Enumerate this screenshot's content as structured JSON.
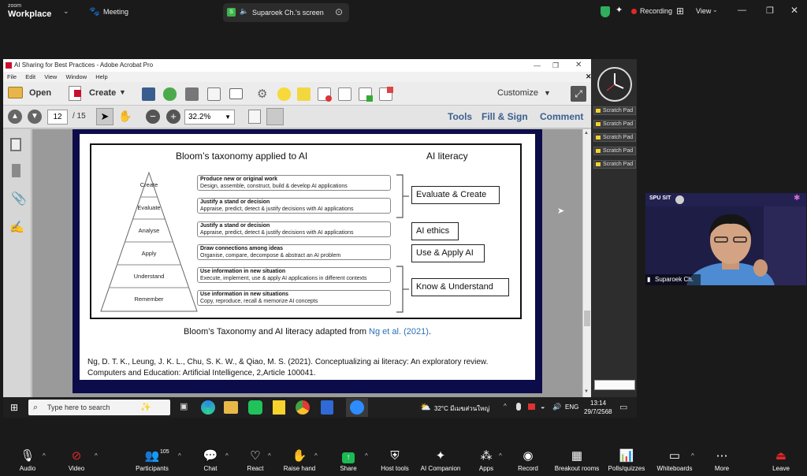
{
  "zoom_top": {
    "logo_line1": "zoom",
    "logo_line2": "Workplace",
    "meeting_label": "Meeting",
    "screen_owner": "Suparoek Ch.'s screen",
    "recording_label": "Recording",
    "view_label": "View"
  },
  "acrobat": {
    "title": "AI Sharing for Best Practices - Adobe Acrobat Pro",
    "menu": [
      "File",
      "Edit",
      "View",
      "Window",
      "Help"
    ],
    "open_label": "Open",
    "create_label": "Create",
    "customize_label": "Customize",
    "page_current": "12",
    "page_total": "/ 15",
    "zoom_value": "32.2%",
    "tools_label": "Tools",
    "fill_sign_label": "Fill & Sign",
    "comment_label": "Comment"
  },
  "slide": {
    "title": "Bloom’s taxonomy applied to AI",
    "literacy_title": "AI literacy",
    "pyramid": [
      "Create",
      "Evaluate",
      "Analyse",
      "Apply",
      "Understand",
      "Remember"
    ],
    "levels": [
      {
        "head": "Produce new or original work",
        "desc": "Design, assemble, construct, build & develop AI applications"
      },
      {
        "head": "Justify a stand or decision",
        "desc": "Appraise, predict, detect & justify decisions with AI applications"
      },
      {
        "head": "Justify a stand or decision",
        "desc": "Appraise, predict, detect & justify decisions with AI applications"
      },
      {
        "head": "Draw connections among ideas",
        "desc": "Organise, compare, decompose & abstract an AI problem"
      },
      {
        "head": "Use information in new situation",
        "desc": "Execute, implement, use & apply AI applications in different contexts"
      },
      {
        "head": "Use information in new situations",
        "desc": "Copy, reproduce, recall & memorize AI concepts"
      }
    ],
    "literacy": [
      "Evaluate & Create",
      "AI ethics",
      "Use & Apply AI",
      "Know & Understand"
    ],
    "caption_text": "Bloom’s Taxonomy and AI literacy adapted from ",
    "caption_link": "Ng et al. (2021)",
    "caption_end": ".",
    "reference": "Ng, D. T. K., Leung, J. K. L., Chu, S. K. W., & Qiao, M. S. (2021). Conceptualizing ai literacy: An exploratory review. Computers and Education: Artificial Intelligence, 2,Article 100041."
  },
  "scratch_pads": [
    "Scratch Pad",
    "Scratch Pad",
    "Scratch Pad",
    "Scratch Pad",
    "Scratch Pad"
  ],
  "taskbar": {
    "search_placeholder": "Type here to search",
    "weather": "32°C  มีเมฆส่วนใหญ่",
    "lang": "ENG",
    "time": "13:14",
    "date": "29/7/2568"
  },
  "video": {
    "name": "Suparoek Ch.",
    "banner": "SPU SIT"
  },
  "zoom_bottom": {
    "items": [
      {
        "label": "Audio",
        "icon": "microphone-muted-icon"
      },
      {
        "label": "Video",
        "icon": "camera-off-icon"
      },
      {
        "label": "Participants",
        "icon": "participants-icon",
        "count": "105"
      },
      {
        "label": "Chat",
        "icon": "chat-icon"
      },
      {
        "label": "React",
        "icon": "heart-icon"
      },
      {
        "label": "Raise hand",
        "icon": "hand-icon"
      },
      {
        "label": "Share",
        "icon": "share-icon"
      },
      {
        "label": "Host tools",
        "icon": "shield-icon"
      },
      {
        "label": "AI Companion",
        "icon": "sparkle-icon"
      },
      {
        "label": "Apps",
        "icon": "apps-icon"
      },
      {
        "label": "Record",
        "icon": "record-icon"
      },
      {
        "label": "Breakout rooms",
        "icon": "breakout-icon"
      },
      {
        "label": "Polls/quizzes",
        "icon": "polls-icon"
      },
      {
        "label": "Whiteboards",
        "icon": "whiteboard-icon"
      },
      {
        "label": "More",
        "icon": "more-icon"
      },
      {
        "label": "Leave",
        "icon": "leave-icon"
      }
    ]
  },
  "colors": {
    "zoom_bg": "#1a1a1a",
    "slide_bg": "#0c0c4a",
    "recording_dot": "#e02828",
    "share_green": "#1db954",
    "link_blue": "#2a6fb5",
    "leave_red": "#e02828"
  }
}
